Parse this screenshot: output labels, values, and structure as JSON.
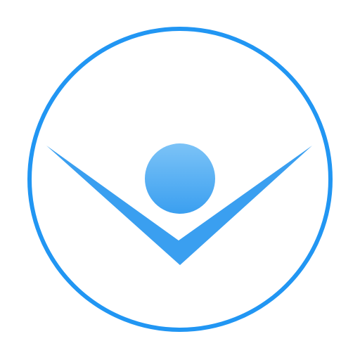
{
  "icon": {
    "name": "person-checkmark-logo-icon",
    "colors": {
      "ring": "#2196F3",
      "chevron": "#3A9FF0",
      "head_top": "#7CC3F7",
      "head_bottom": "#3A9FF0",
      "background": "#FFFFFF"
    }
  }
}
